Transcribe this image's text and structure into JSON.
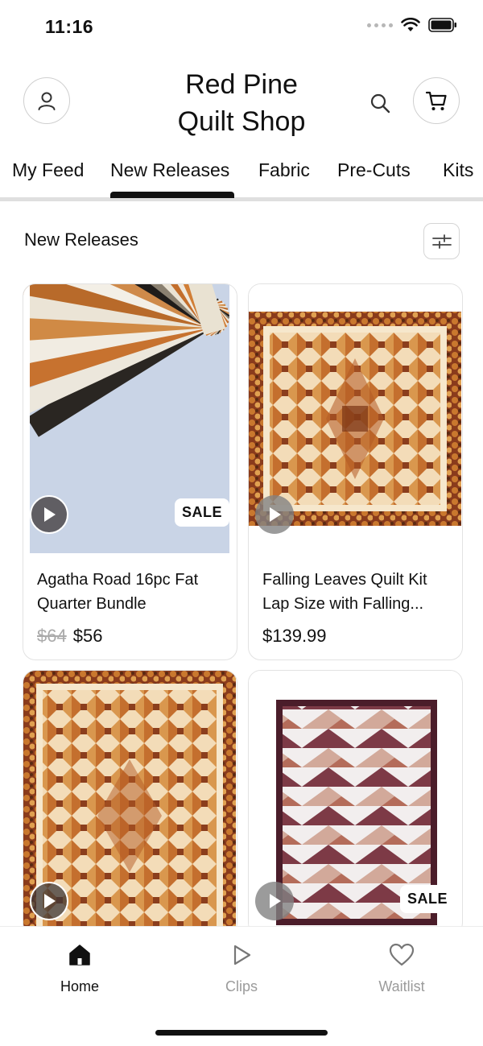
{
  "status_bar": {
    "time": "11:16"
  },
  "header": {
    "title_line1": "Red Pine",
    "title_line2": "Quilt Shop",
    "icons": [
      "user-icon",
      "search-icon",
      "cart-icon"
    ]
  },
  "tabs": [
    {
      "label": "My Feed"
    },
    {
      "label": "New Releases",
      "active": true
    },
    {
      "label": "Fabric"
    },
    {
      "label": "Pre-Cuts"
    },
    {
      "label": "Kits"
    }
  ],
  "section": {
    "title": "New Releases",
    "filter_icon": "sliders-icon"
  },
  "products": [
    {
      "name_line1": "Agatha Road 16pc Fat",
      "name_line2": "Quarter Bundle",
      "old_price": "$64",
      "price": "$56",
      "badge": "SALE"
    },
    {
      "name_line1": "Falling Leaves Quilt Kit",
      "name_line2": "Lap Size with Falling...",
      "price": "$139.99"
    },
    {
      "name_line1": "",
      "name_line2": "",
      "price": ""
    },
    {
      "name_line1": "",
      "name_line2": "",
      "price": "",
      "badge": "SALE"
    }
  ],
  "bottom_nav": [
    {
      "label": "Home",
      "icon": "home-icon",
      "active": true
    },
    {
      "label": "Clips",
      "icon": "play-outline-icon"
    },
    {
      "label": "Waitlist",
      "icon": "heart-icon"
    }
  ],
  "colors": {
    "accent": "#111111",
    "muted": "#9b9b9b",
    "quilt_orange": "#c7722f"
  }
}
